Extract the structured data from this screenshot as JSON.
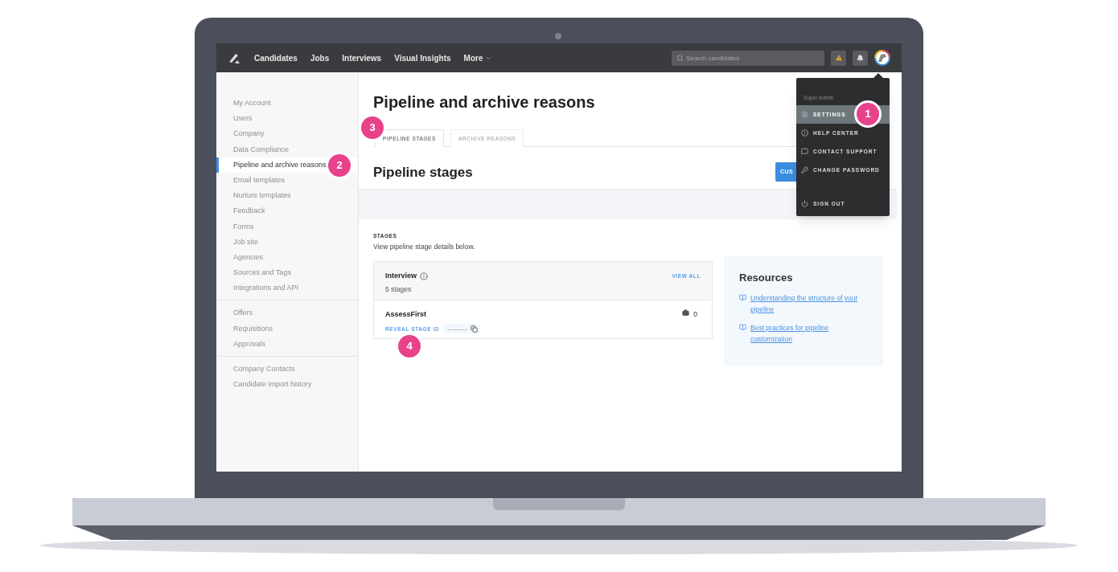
{
  "nav": {
    "items": [
      "Candidates",
      "Jobs",
      "Interviews",
      "Visual Insights"
    ],
    "more": "More",
    "search": {
      "placeholder": "Search candidates"
    }
  },
  "user_menu": {
    "role": "Super Admin",
    "items": [
      {
        "label": "SETTINGS",
        "kind": "gear",
        "selected": true,
        "callout": "1"
      },
      {
        "label": "HELP CENTER",
        "kind": "info",
        "selected": false
      },
      {
        "label": "CONTACT SUPPORT",
        "kind": "chat",
        "selected": false
      },
      {
        "label": "CHANGE PASSWORD",
        "kind": "key",
        "selected": false
      },
      {
        "label": "SIGN OUT",
        "kind": "power",
        "selected": false
      }
    ]
  },
  "sidebar": {
    "groups": [
      [
        {
          "label": "My Account",
          "selected": false
        },
        {
          "label": "Users",
          "selected": false
        },
        {
          "label": "Company",
          "selected": false
        },
        {
          "label": "Data Compliance",
          "selected": false
        },
        {
          "label": "Pipeline and archive reasons",
          "selected": true,
          "callout": "2"
        },
        {
          "label": "Email templates",
          "selected": false
        },
        {
          "label": "Nurture templates",
          "selected": false
        },
        {
          "label": "Feedback",
          "selected": false
        },
        {
          "label": "Forms",
          "selected": false
        },
        {
          "label": "Job site",
          "selected": false
        },
        {
          "label": "Agencies",
          "selected": false
        },
        {
          "label": "Sources and Tags",
          "selected": false
        },
        {
          "label": "Integrations and API",
          "selected": false
        }
      ],
      [
        {
          "label": "Offers",
          "selected": false
        },
        {
          "label": "Requisitions",
          "selected": false
        },
        {
          "label": "Approvals",
          "selected": false
        }
      ],
      [
        {
          "label": "Company Contacts",
          "selected": false
        },
        {
          "label": "Candidate import history",
          "selected": false
        }
      ]
    ]
  },
  "page_title": "Pipeline and archive reasons",
  "tabs": [
    {
      "label": "PIPELINE STAGES",
      "selected": true,
      "callout": "3"
    },
    {
      "label": "ARCHIVE REASONS",
      "selected": false
    }
  ],
  "section_title": "Pipeline stages",
  "customize_button": "CUS",
  "stages": {
    "heading": "STAGES",
    "description": "View pipeline stage details below.",
    "group": {
      "name": "Interview",
      "count": "5 stages",
      "view_all": "VIEW ALL"
    },
    "items": [
      {
        "name": "AssessFirst",
        "reveal": "REVEAL STAGE ID",
        "id_mask": "......................",
        "jobs": "0",
        "callout": "4"
      }
    ]
  },
  "resources": {
    "title": "Resources",
    "links": [
      "Understanding the structure of your pipeline",
      "Best practices for pipeline customization"
    ]
  }
}
